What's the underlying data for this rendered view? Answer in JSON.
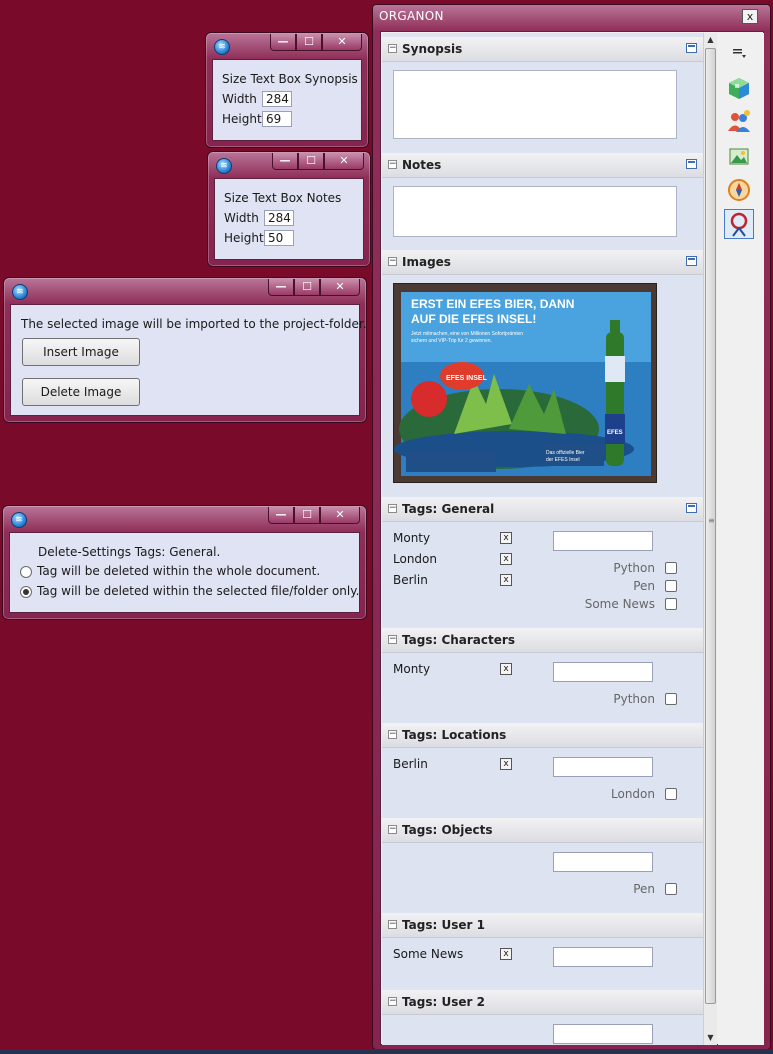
{
  "window_controls": {
    "minimize": "—",
    "maximize": "☐",
    "close": "✕"
  },
  "synopsis_size_dialog": {
    "title_label": "Size Text Box Synopsis",
    "width_label": "Width",
    "width_value": "284",
    "height_label": "Height",
    "height_value": "69"
  },
  "notes_size_dialog": {
    "title_label": "Size Text Box Notes",
    "width_label": "Width",
    "width_value": "284",
    "height_label": "Height",
    "height_value": "50"
  },
  "image_dialog": {
    "message": "The selected image will be imported to the project-folder.",
    "insert_label": "Insert Image",
    "delete_label": "Delete Image"
  },
  "delete_settings_dialog": {
    "heading": "Delete-Settings Tags: General.",
    "option_whole": "Tag will be deleted within the whole document.",
    "option_selected": "Tag will be deleted within the selected file/folder only.",
    "selected_option": "selected"
  },
  "organon": {
    "title": "ORGANON",
    "close": "x",
    "sections": {
      "synopsis": "Synopsis",
      "notes": "Notes",
      "images": "Images",
      "tags_general": "Tags: General",
      "tags_characters": "Tags: Characters",
      "tags_locations": "Tags: Locations",
      "tags_objects": "Tags: Objects",
      "tags_user1": "Tags: User 1",
      "tags_user2": "Tags: User 2"
    },
    "image_poster": {
      "headline1": "ERST EIN EFES BIER, DANN",
      "headline2": "AUF DIE EFES INSEL!",
      "subline1": "Jetzt mitmachen, eine von Millionen Sofortprämien",
      "subline2": "sichern und VIP-Trip für 2 gewinnen.",
      "island_label": "EFES INSEL",
      "footer1": "Das offizielle Bier",
      "footer2": "der EFES Insel",
      "bottle_label": "EFES"
    },
    "tags_general": {
      "assigned": [
        "Monty",
        "London",
        "Berlin"
      ],
      "suggestions": [
        "Python",
        "Pen",
        "Some News"
      ]
    },
    "tags_characters": {
      "assigned": [
        "Monty"
      ],
      "suggestions": [
        "Python"
      ]
    },
    "tags_locations": {
      "assigned": [
        "Berlin"
      ],
      "suggestions": [
        "London"
      ]
    },
    "tags_objects": {
      "assigned": [],
      "suggestions": [
        "Pen"
      ]
    },
    "tags_user1": {
      "assigned": [
        "Some News"
      ],
      "suggestions": []
    },
    "tags_user2": {
      "assigned": [],
      "suggestions": []
    },
    "check_mark": "x",
    "toolbar_icons": [
      "options-menu-icon",
      "project-cube-icon",
      "characters-icon",
      "image-manager-icon",
      "navigator-compass-icon",
      "inspector-magnifier-icon"
    ]
  }
}
